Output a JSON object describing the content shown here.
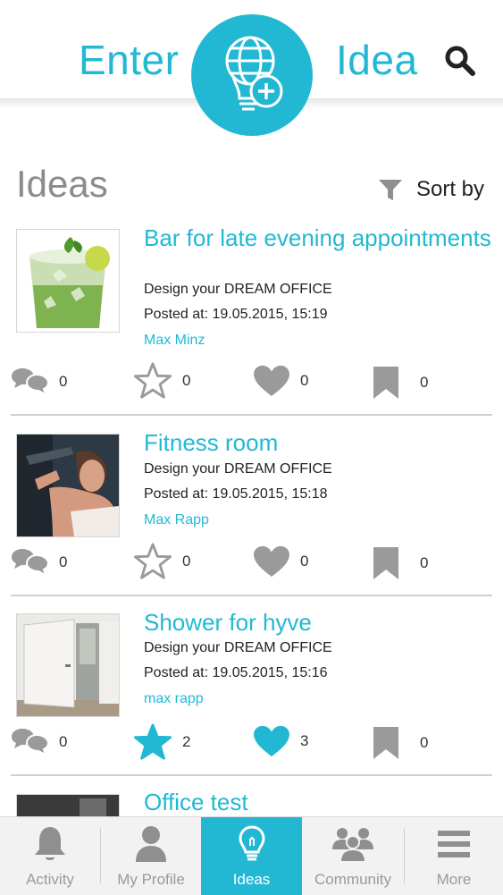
{
  "header": {
    "enter": "Enter",
    "idea": "Idea"
  },
  "section": {
    "title": "Ideas",
    "sort_label": "Sort by"
  },
  "ideas": [
    {
      "title": "Bar for late evening appointments",
      "challenge": "Design your DREAM OFFICE",
      "posted": "Posted at: 19.05.2015, 15:19",
      "author": "Max Minz",
      "comments": "0",
      "stars": "0",
      "likes": "0",
      "bookmarks": "0"
    },
    {
      "title": "Fitness room",
      "challenge": "Design your DREAM OFFICE",
      "posted": "Posted at: 19.05.2015, 15:18",
      "author": "Max Rapp",
      "comments": "0",
      "stars": "0",
      "likes": "0",
      "bookmarks": "0"
    },
    {
      "title": "Shower for hyve",
      "challenge": "Design your DREAM OFFICE",
      "posted": "Posted at: 19.05.2015, 15:16",
      "author": "max rapp",
      "comments": "0",
      "stars": "2",
      "likes": "3",
      "bookmarks": "0"
    },
    {
      "title": "Office test"
    }
  ],
  "tabs": [
    {
      "label": "Activity",
      "icon": "bell-icon"
    },
    {
      "label": "My Profile",
      "icon": "person-icon"
    },
    {
      "label": "Ideas",
      "icon": "lightbulb-icon",
      "active": true
    },
    {
      "label": "Community",
      "icon": "group-icon"
    },
    {
      "label": "More",
      "icon": "menu-icon"
    }
  ],
  "colors": {
    "accent": "#22b8d4",
    "icon_gray": "#8f8f8f",
    "title_gray": "#8c8c8c"
  }
}
